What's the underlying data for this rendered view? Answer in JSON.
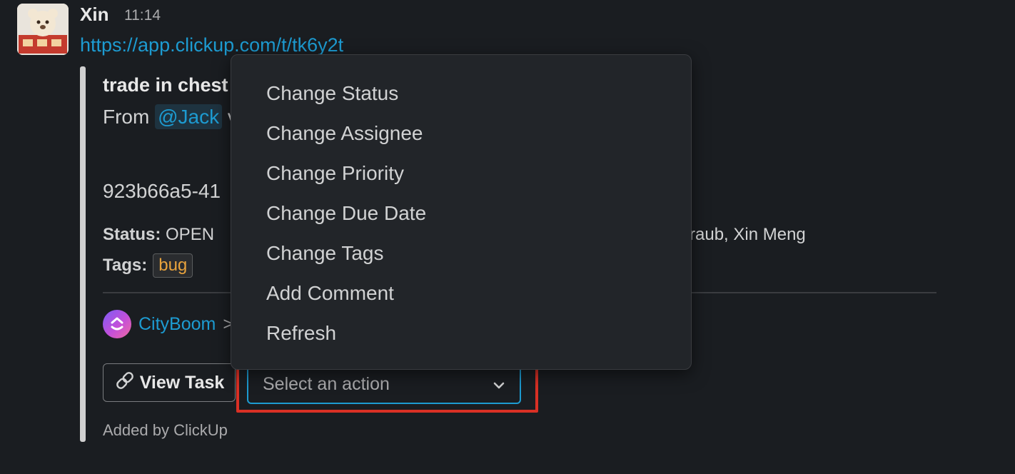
{
  "message": {
    "author": "Xin",
    "time": "11:14",
    "link": "https://app.clickup.com/t/tk6y2t"
  },
  "attachment": {
    "title": "trade in chest",
    "from_prefix": "From ",
    "mention": "@Jack",
    "from_suffix": " v",
    "task_id": "923b66a5-41",
    "status_label": "Status:",
    "status_value": "OPEN",
    "assignees_partial": "t Straub, Xin Meng",
    "tags_label": "Tags:",
    "tag": "bug",
    "app_name": "CityBoom",
    "crumb_separator": ">",
    "view_task_label": "View Task",
    "select_placeholder": "Select an action",
    "added_by": "Added by ClickUp"
  },
  "menu": {
    "items": [
      "Change Status",
      "Change Assignee",
      "Change Priority",
      "Change Due Date",
      "Change Tags",
      "Add Comment",
      "Refresh"
    ]
  },
  "colors": {
    "background": "#1a1d21",
    "link": "#1d9bd1",
    "tag_text": "#e8a33d",
    "highlight_box": "#d93025",
    "menu_bg": "#222529"
  },
  "icons": {
    "avatar": "avatar-image",
    "app": "clickup-icon",
    "view_task": "link-icon",
    "select": "chevron-down-icon"
  }
}
